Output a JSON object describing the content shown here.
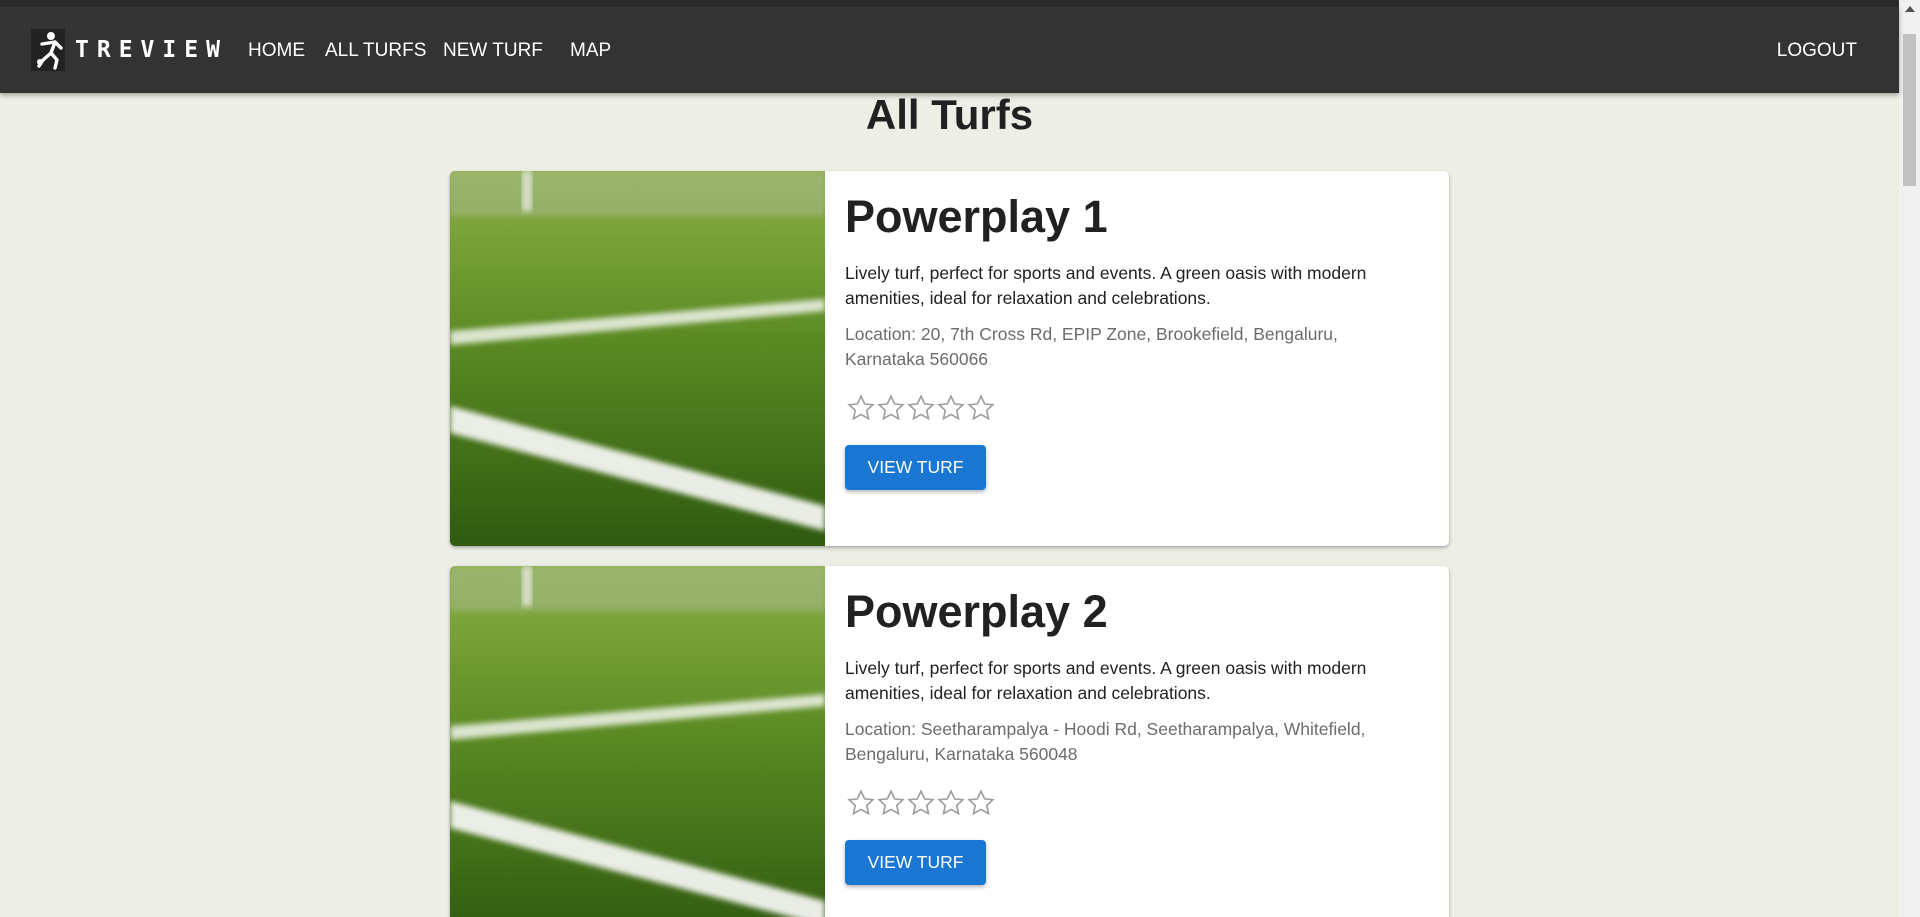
{
  "navbar": {
    "brand": "TREVIEW",
    "links": [
      {
        "label": "HOME"
      },
      {
        "label": "ALL TURFS"
      },
      {
        "label": "NEW TURF"
      },
      {
        "label": "MAP"
      }
    ],
    "logout": "LOGOUT",
    "colors": {
      "background": "#333333",
      "text": "#ffffff"
    }
  },
  "page": {
    "title": "All Turfs",
    "background": "#edeee6"
  },
  "turfs": [
    {
      "name": "Powerplay 1",
      "description": "Lively turf, perfect for sports and events. A green oasis with modern amenities, ideal for relaxation and celebrations.",
      "location": "Location: 20, 7th Cross Rd, EPIP Zone, Brookefield, Bengaluru, Karnataka 560066",
      "rating": 0,
      "max_rating": 5,
      "button": "VIEW TURF",
      "image_icon": "turf-grass-photo"
    },
    {
      "name": "Powerplay 2",
      "description": "Lively turf, perfect for sports and events. A green oasis with modern amenities, ideal for relaxation and celebrations.",
      "location": "Location: Seetharampalya - Hoodi Rd, Seetharampalya, Whitefield, Bengaluru, Karnataka 560048",
      "rating": 0,
      "max_rating": 5,
      "button": "VIEW TURF",
      "image_icon": "turf-grass-photo"
    }
  ],
  "accent_color": "#1976d2"
}
